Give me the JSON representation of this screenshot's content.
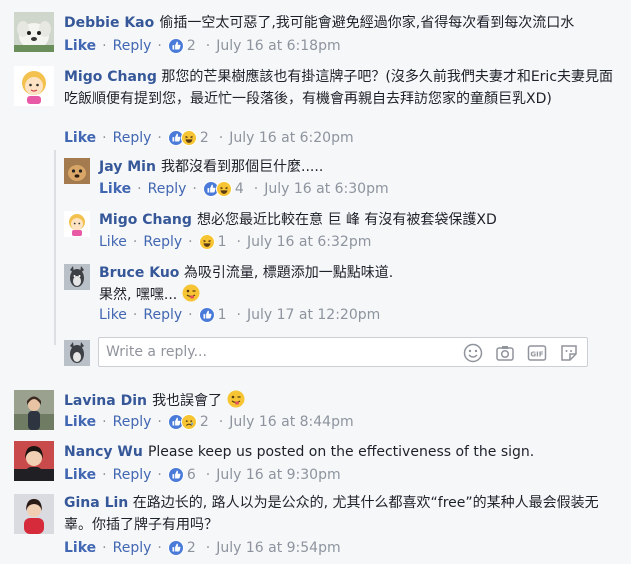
{
  "comments": [
    {
      "name": "Debbie Kao",
      "text": "偷插一空太可惡了,我可能會避免經過你家,省得每次看到每次流口水",
      "like_label": "Like",
      "reply_label": "Reply",
      "reaction_count": "2",
      "time": "July 16 at 6:18pm",
      "avatar_icon": "dog-avatar-icon",
      "reactions": [
        "like-icon"
      ]
    },
    {
      "name": "Migo Chang",
      "text": "那您的芒果樹應該也有掛這牌子吧？(沒多久前我們夫妻才和Eric夫妻見面吃飯順便有提到您，最近忙一段落後，有機會再親自去拜訪您家的童顏巨乳XD)",
      "like_label": "Like",
      "reply_label": "Reply",
      "reaction_count": "2",
      "time": "July 16 at 6:20pm",
      "avatar_icon": "cartoon-girl-avatar-icon",
      "reactions": [
        "like-icon",
        "haha-icon"
      ]
    },
    {
      "name": "Jay Min",
      "text": "我都沒看到那個巨什麼.....",
      "like_label": "Like",
      "reply_label": "Reply",
      "reaction_count": "4",
      "time": "July 16 at 6:30pm",
      "avatar_icon": "dog-avatar-icon",
      "reactions": [
        "like-icon",
        "haha-icon"
      ]
    },
    {
      "name": "Migo Chang",
      "text": "想必您最近比較在意 巨 峰 有沒有被套袋保護XD",
      "like_label": "Like",
      "reply_label": "Reply",
      "reaction_count": "1",
      "time": "July 16 at 6:32pm",
      "avatar_icon": "cartoon-girl-avatar-icon",
      "reactions": [
        "haha-icon"
      ]
    },
    {
      "name": "Bruce Kuo",
      "text": "為吸引流量, 標題添加一點點味道.",
      "text2": "果然, 嘿嘿...",
      "like_label": "Like",
      "reply_label": "Reply",
      "reaction_count": "1",
      "time": "July 17 at 12:20pm",
      "avatar_icon": "dog-avatar-icon",
      "reactions": [
        "like-icon"
      ]
    },
    {
      "name": "Lavina Din",
      "text": "我也誤會了",
      "like_label": "Like",
      "reply_label": "Reply",
      "reaction_count": "2",
      "time": "July 16 at 8:44pm",
      "avatar_icon": "person-avatar-icon",
      "reactions": [
        "like-icon",
        "sad-icon"
      ]
    },
    {
      "name": "Nancy Wu",
      "text": "Please keep us posted on the effectiveness of the sign.",
      "like_label": "Like",
      "reply_label": "Reply",
      "reaction_count": "6",
      "time": "July 16 at 9:30pm",
      "avatar_icon": "person-avatar-icon",
      "reactions": [
        "like-icon"
      ]
    },
    {
      "name": "Gina Lin",
      "text": "在路边长的, 路人以为是公众的, 尤其什么都喜欢“free”的某种人最会假装无辜。你插了牌子有用吗？",
      "like_label": "Like",
      "reply_label": "Reply",
      "reaction_count": "2",
      "time": "July 16 at 9:54pm",
      "avatar_icon": "person-avatar-icon",
      "reactions": [
        "like-icon"
      ]
    }
  ],
  "reply_box": {
    "placeholder": "Write a reply...",
    "icons": [
      "emoji-icon",
      "camera-icon",
      "gif-icon",
      "sticker-icon"
    ]
  },
  "colors": {
    "name_link": "#365899",
    "action_link": "#4267b2",
    "meta_gray": "#8d949e",
    "background": "#f6f7f9"
  }
}
